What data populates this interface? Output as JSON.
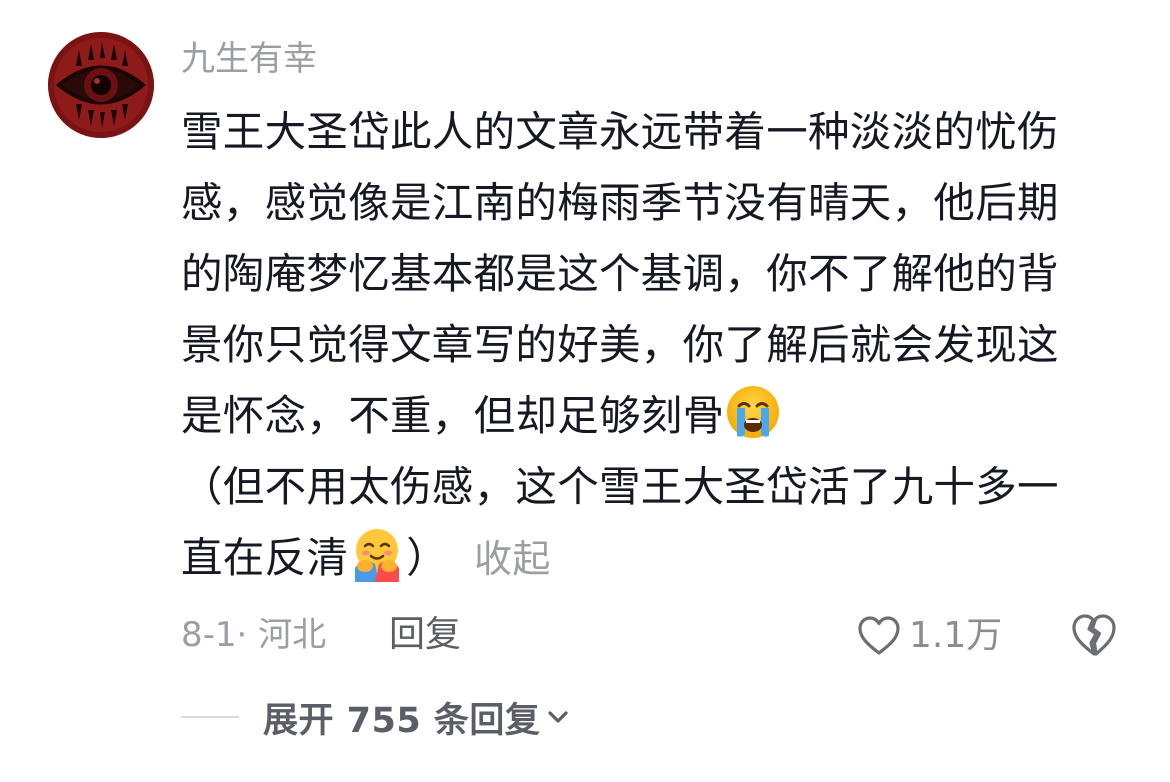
{
  "comment": {
    "username": "九生有幸",
    "lines": [
      "雪王大圣岱此人的文章永远带着一种淡淡的忧伤",
      "感，感觉像是江南的梅雨季节没有晴天，他后期",
      "的陶庵梦忆基本都是这个基调，你不了解他的背",
      "景你只觉得文章写的好美，你了解后就会发现这",
      "是怀念，不重，但却足够刻骨",
      "（但不用太伤感，这个雪王大圣岱活了九十多一",
      "直在反清",
      "）"
    ],
    "emojis": [
      "crying-face",
      "hugging-face"
    ],
    "collapse_label": "收起",
    "meta": "8-1· 河北",
    "reply_label": "回复",
    "like_count": "1.1万",
    "expand_label": "展开 755 条回复"
  },
  "colors": {
    "text": "#161823",
    "secondary": "#9b9ea5",
    "action": "#5b5e66"
  }
}
